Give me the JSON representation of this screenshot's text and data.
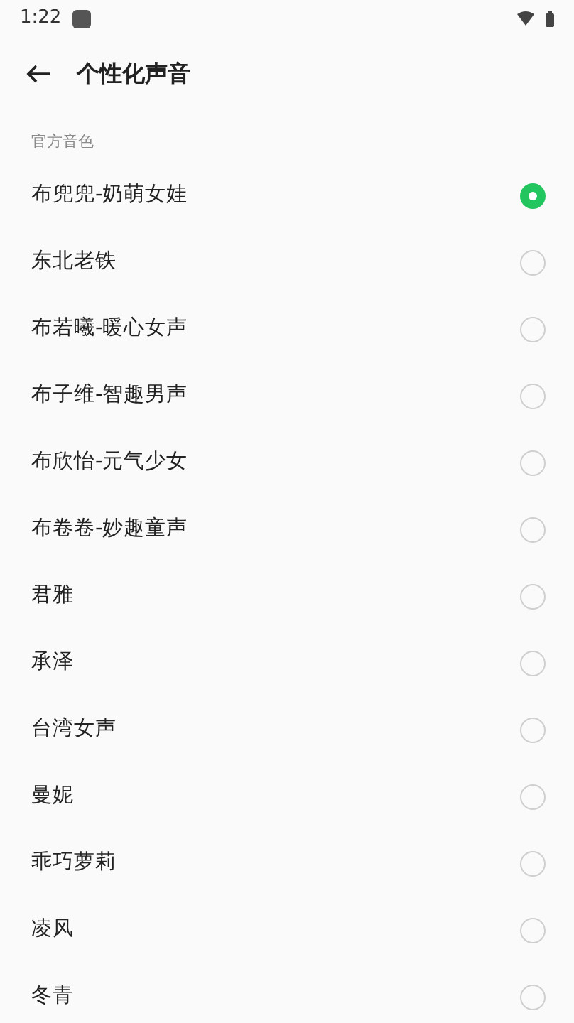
{
  "status_bar": {
    "time": "1:22"
  },
  "header": {
    "title": "个性化声音"
  },
  "section": {
    "title": "官方音色"
  },
  "voices": [
    {
      "label": "布兜兜-奶萌女娃",
      "selected": true
    },
    {
      "label": "东北老铁",
      "selected": false
    },
    {
      "label": "布若曦-暖心女声",
      "selected": false
    },
    {
      "label": "布子维-智趣男声",
      "selected": false
    },
    {
      "label": "布欣怡-元气少女",
      "selected": false
    },
    {
      "label": "布卷卷-妙趣童声",
      "selected": false
    },
    {
      "label": "君雅",
      "selected": false
    },
    {
      "label": "承泽",
      "selected": false
    },
    {
      "label": "台湾女声",
      "selected": false
    },
    {
      "label": "曼妮",
      "selected": false
    },
    {
      "label": "乖巧萝莉",
      "selected": false
    },
    {
      "label": "凌风",
      "selected": false
    },
    {
      "label": "冬青",
      "selected": false
    }
  ]
}
